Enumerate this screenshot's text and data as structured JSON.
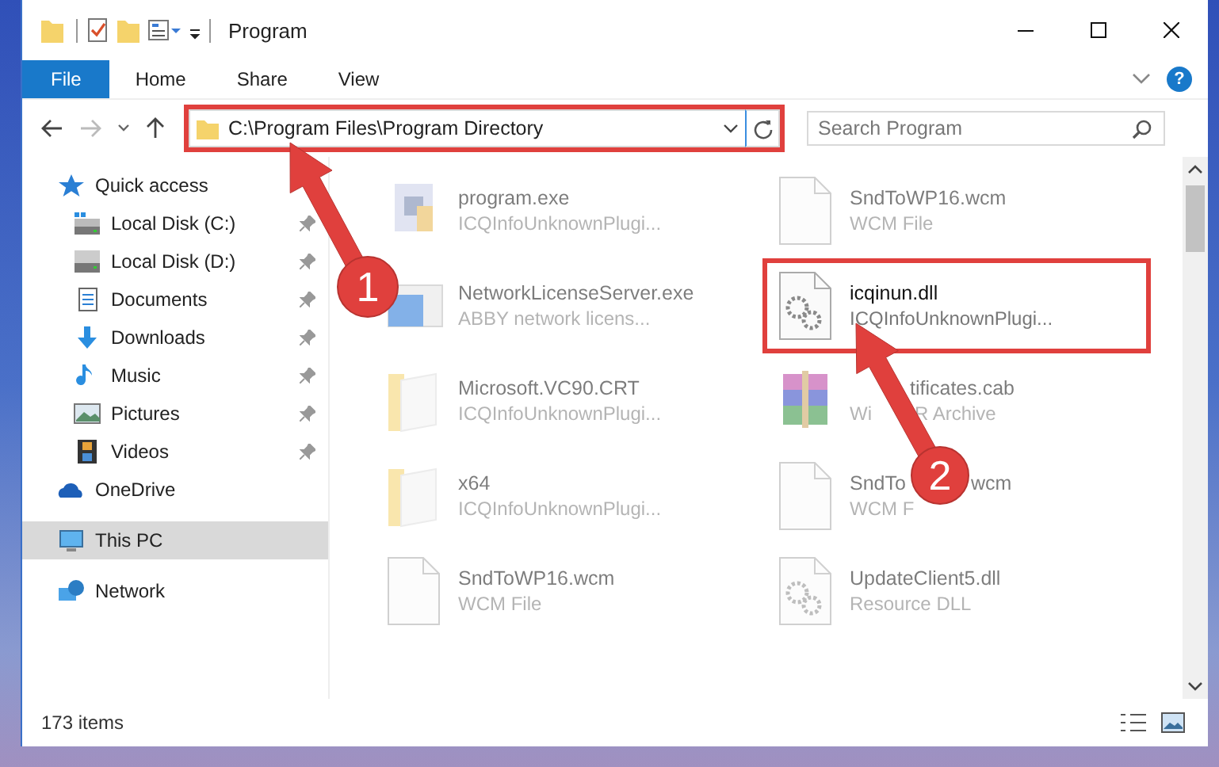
{
  "window": {
    "title": "Program"
  },
  "ribbon": {
    "tabs": [
      {
        "label": "File",
        "selected": true
      },
      {
        "label": "Home",
        "selected": false
      },
      {
        "label": "Share",
        "selected": false
      },
      {
        "label": "View",
        "selected": false
      }
    ],
    "help": "?"
  },
  "address": {
    "path": "C:\\Program Files\\Program Directory",
    "highlighted": true
  },
  "search": {
    "placeholder": "Search Program"
  },
  "sidebar": {
    "items": [
      {
        "label": "Quick access",
        "kind": "star",
        "selected": false,
        "children": [
          {
            "label": "Local Disk (C:)",
            "kind": "disk-c",
            "selected": false,
            "pinned": true
          },
          {
            "label": "Local Disk (D:)",
            "kind": "disk",
            "selected": false,
            "pinned": true
          },
          {
            "label": "Documents",
            "kind": "documents",
            "selected": false,
            "pinned": true
          },
          {
            "label": "Downloads",
            "kind": "downloads",
            "selected": false,
            "pinned": true
          },
          {
            "label": "Music",
            "kind": "music",
            "selected": false,
            "pinned": true
          },
          {
            "label": "Pictures",
            "kind": "pictures",
            "selected": false,
            "pinned": true
          },
          {
            "label": "Videos",
            "kind": "videos",
            "selected": false,
            "pinned": true
          }
        ]
      },
      {
        "label": "OneDrive",
        "kind": "cloud",
        "selected": false
      },
      {
        "label": "This PC",
        "kind": "pc",
        "selected": true
      },
      {
        "label": "Network",
        "kind": "network",
        "selected": false
      }
    ]
  },
  "files": [
    {
      "name": "program.exe",
      "type": "ICQInfoUnknownPlugi...",
      "kind": "exe",
      "highlighted": false
    },
    {
      "name": "SndToWP16.wcm",
      "type": "WCM File",
      "kind": "file",
      "highlighted": false
    },
    {
      "name": "NetworkLicenseServer.exe",
      "type": "ABBY network licens...",
      "kind": "app",
      "highlighted": false
    },
    {
      "name": "icqinun.dll",
      "type": "ICQInfoUnknownPlugi...",
      "kind": "dll",
      "highlighted": true
    },
    {
      "name": "Microsoft.VC90.CRT",
      "type": "ICQInfoUnknownPlugi...",
      "kind": "folder",
      "highlighted": false
    },
    {
      "name": "tificates.cab",
      "type": "Wi",
      "type_tail": "R Archive",
      "kind": "archive",
      "highlighted": false
    },
    {
      "name": "x64",
      "type": "ICQInfoUnknownPlugi...",
      "kind": "folder",
      "highlighted": false
    },
    {
      "name": "SndTo",
      "name_tail": "wcm",
      "type": "WCM F",
      "kind": "file",
      "highlighted": false
    },
    {
      "name": "SndToWP16.wcm",
      "type": "WCM File",
      "kind": "file",
      "highlighted": false
    },
    {
      "name": "UpdateClient5.dll",
      "type": "Resource DLL",
      "kind": "dll",
      "highlighted": false
    }
  ],
  "status_bar": {
    "count": "173 items"
  },
  "annotations": [
    {
      "number": "1"
    },
    {
      "number": "2"
    }
  ]
}
